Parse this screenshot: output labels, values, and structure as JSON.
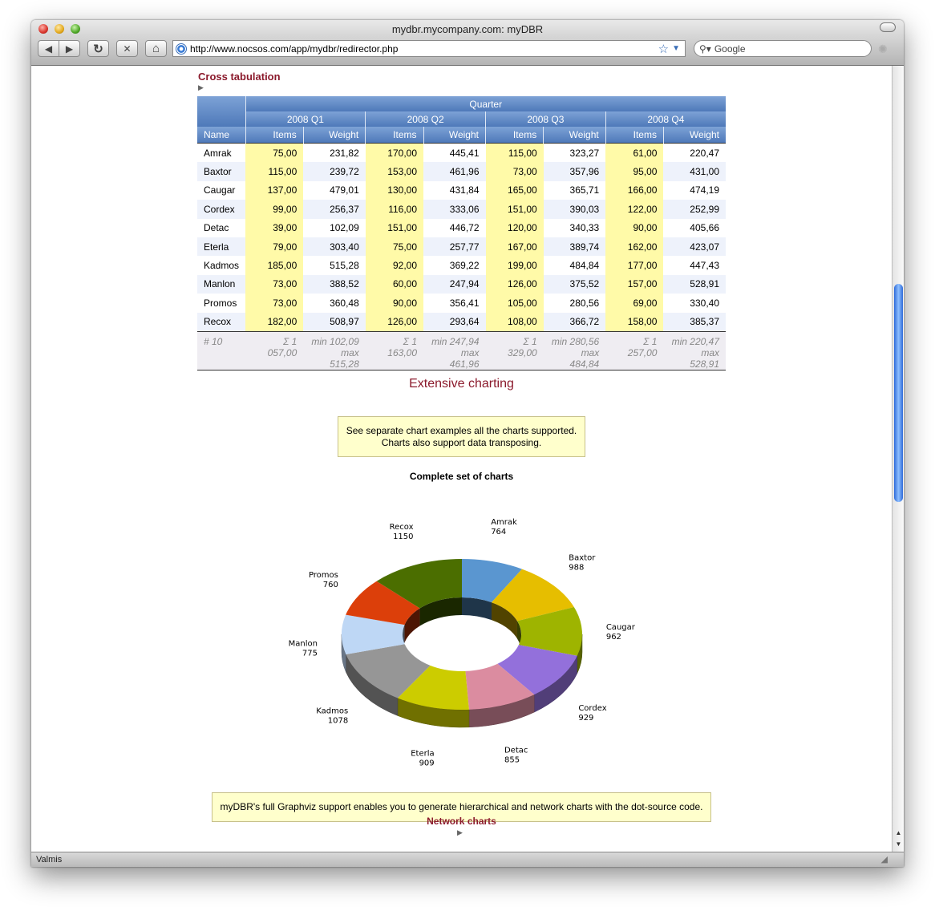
{
  "window": {
    "title": "mydbr.mycompany.com: myDBR"
  },
  "toolbar": {
    "back_icon": "◀",
    "forward_icon": "▶",
    "reload_icon": "↻",
    "stop_icon": "✕",
    "home_icon": "⌂",
    "url": "http://www.nocsos.com/app/mydbr/redirector.php",
    "search_placeholder": "Google"
  },
  "status": {
    "text": "Valmis"
  },
  "cross": {
    "title": "Cross tabulation",
    "group_header": "Quarter",
    "quarters": [
      "2008 Q1",
      "2008 Q2",
      "2008 Q3",
      "2008 Q4"
    ],
    "col_name": "Name",
    "col_items": "Items",
    "col_weight": "Weight",
    "rows": [
      {
        "name": "Amrak",
        "v": [
          "75,00",
          "231,82",
          "170,00",
          "445,41",
          "115,00",
          "323,27",
          "61,00",
          "220,47"
        ]
      },
      {
        "name": "Baxtor",
        "v": [
          "115,00",
          "239,72",
          "153,00",
          "461,96",
          "73,00",
          "357,96",
          "95,00",
          "431,00"
        ]
      },
      {
        "name": "Caugar",
        "v": [
          "137,00",
          "479,01",
          "130,00",
          "431,84",
          "165,00",
          "365,71",
          "166,00",
          "474,19"
        ]
      },
      {
        "name": "Cordex",
        "v": [
          "99,00",
          "256,37",
          "116,00",
          "333,06",
          "151,00",
          "390,03",
          "122,00",
          "252,99"
        ]
      },
      {
        "name": "Detac",
        "v": [
          "39,00",
          "102,09",
          "151,00",
          "446,72",
          "120,00",
          "340,33",
          "90,00",
          "405,66"
        ]
      },
      {
        "name": "Eterla",
        "v": [
          "79,00",
          "303,40",
          "75,00",
          "257,77",
          "167,00",
          "389,74",
          "162,00",
          "423,07"
        ]
      },
      {
        "name": "Kadmos",
        "v": [
          "185,00",
          "515,28",
          "92,00",
          "369,22",
          "199,00",
          "484,84",
          "177,00",
          "447,43"
        ]
      },
      {
        "name": "Manlon",
        "v": [
          "73,00",
          "388,52",
          "60,00",
          "247,94",
          "126,00",
          "375,52",
          "157,00",
          "528,91"
        ]
      },
      {
        "name": "Promos",
        "v": [
          "73,00",
          "360,48",
          "90,00",
          "356,41",
          "105,00",
          "280,56",
          "69,00",
          "330,40"
        ]
      },
      {
        "name": "Recox",
        "v": [
          "182,00",
          "508,97",
          "126,00",
          "293,64",
          "108,00",
          "366,72",
          "158,00",
          "385,37"
        ]
      }
    ],
    "footer": {
      "count": "# 10",
      "cells": [
        {
          "a": "Σ 1 057,00"
        },
        {
          "a": "min 102,09",
          "b": "max 515,28"
        },
        {
          "a": "Σ 1 163,00"
        },
        {
          "a": "min 247,94",
          "b": "max 461,96"
        },
        {
          "a": "Σ 1 329,00"
        },
        {
          "a": "min 280,56",
          "b": "max 484,84"
        },
        {
          "a": "Σ 1 257,00"
        },
        {
          "a": "min 220,47",
          "b": "max 528,91"
        }
      ]
    }
  },
  "charting": {
    "heading": "Extensive charting",
    "note_line1": "See separate chart examples all the charts supported.",
    "note_line2": "Charts also support data transposing."
  },
  "chart_data": {
    "type": "pie",
    "variant": "3d-donut",
    "title": "Complete set of charts",
    "categories": [
      "Amrak",
      "Baxtor",
      "Caugar",
      "Cordex",
      "Detac",
      "Eterla",
      "Kadmos",
      "Manlon",
      "Promos",
      "Recox"
    ],
    "values": [
      764,
      988,
      962,
      929,
      855,
      909,
      1078,
      775,
      760,
      1150
    ],
    "colors": [
      "#5a96d0",
      "#e6be00",
      "#9eb400",
      "#9370db",
      "#db8ca0",
      "#cccc00",
      "#969696",
      "#bed7f5",
      "#dc3f0a",
      "#4b6e00"
    ]
  },
  "graphviz": {
    "note": "myDBR's full Graphviz support enables you to generate hierarchical and network charts with the dot-source code.",
    "network_title": "Network charts"
  }
}
